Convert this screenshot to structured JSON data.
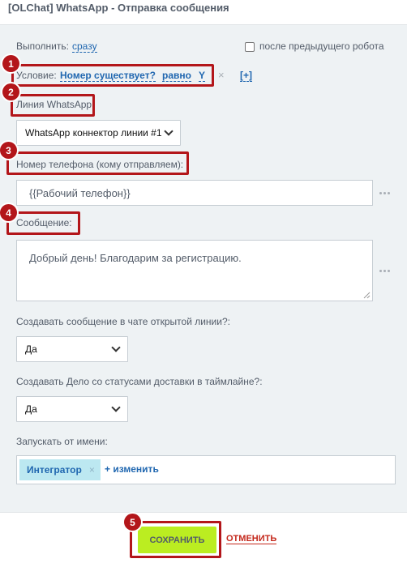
{
  "window": {
    "title": "[OLChat] WhatsApp - Отправка сообщения"
  },
  "execute": {
    "label": "Выполнить:",
    "value": "сразу",
    "after_previous_label": "после предыдущего робота"
  },
  "condition": {
    "label": "Условие:",
    "field": "Номер существует?",
    "operator": "равно",
    "value": "Y",
    "remove": "×",
    "add": "[+]"
  },
  "line": {
    "label": "Линия WhatsApp:",
    "selected": "WhatsApp коннектор линии #1"
  },
  "phone": {
    "label": "Номер телефона (кому отправляем):",
    "value": "{{Рабочий телефон}}"
  },
  "message": {
    "label": "Сообщение:",
    "value": "Добрый день! Благодарим за регистрацию."
  },
  "create_in_chat": {
    "label": "Создавать сообщение в чате открытой линии?:",
    "selected": "Да"
  },
  "create_activity": {
    "label": "Создавать Дело со статусами доставки в таймлайне?:",
    "selected": "Да"
  },
  "run_as": {
    "label": "Запускать от имени:",
    "user": "Интегратор",
    "remove": "×",
    "change": "+ изменить"
  },
  "footer": {
    "save": "СОХРАНИТЬ",
    "cancel": "ОТМЕНИТЬ"
  },
  "markers": [
    "1",
    "2",
    "3",
    "4",
    "5"
  ],
  "colors": {
    "marker": "#b3161a",
    "link": "#2067b0",
    "save_button": "#bbed21",
    "cancel": "#c4281c",
    "panel": "#eef2f4",
    "tag": "#bce8f1"
  }
}
